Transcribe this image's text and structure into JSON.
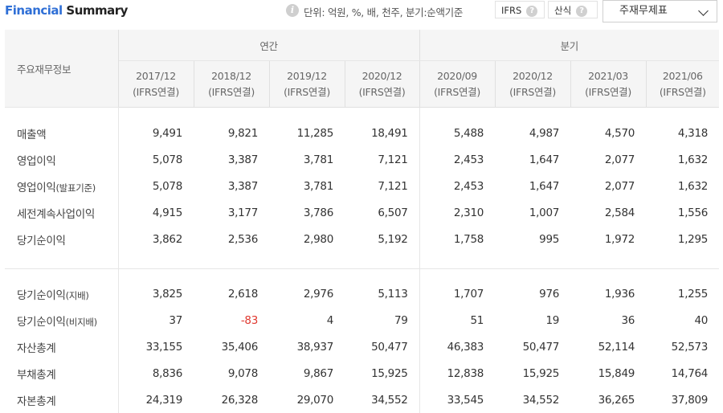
{
  "header": {
    "title_part1": "Financial",
    "title_part2": "Summary",
    "info_icon": "i",
    "unit_text": "단위: 억원, %, 배, 천주, 분기:순액기준",
    "ifrs_label": "IFRS",
    "calc_label": "산식",
    "help_icon": "?",
    "select_value": "주재무제표"
  },
  "table": {
    "label_header": "주요재무정보",
    "annual_header": "연간",
    "quarter_header": "분기",
    "periods": [
      {
        "date": "2017/12",
        "basis": "(IFRS연결)"
      },
      {
        "date": "2018/12",
        "basis": "(IFRS연결)"
      },
      {
        "date": "2019/12",
        "basis": "(IFRS연결)"
      },
      {
        "date": "2020/12",
        "basis": "(IFRS연결)"
      },
      {
        "date": "2020/09",
        "basis": "(IFRS연결)"
      },
      {
        "date": "2020/12",
        "basis": "(IFRS연결)"
      },
      {
        "date": "2021/03",
        "basis": "(IFRS연결)"
      },
      {
        "date": "2021/06",
        "basis": "(IFRS연결)"
      }
    ],
    "rows": [
      {
        "label": "매출액",
        "suffix": "",
        "values": [
          "9,491",
          "9,821",
          "11,285",
          "18,491",
          "5,488",
          "4,987",
          "4,570",
          "4,318"
        ]
      },
      {
        "label": "영업이익",
        "suffix": "",
        "values": [
          "5,078",
          "3,387",
          "3,781",
          "7,121",
          "2,453",
          "1,647",
          "2,077",
          "1,632"
        ]
      },
      {
        "label": "영업이익",
        "suffix": "(발표기준)",
        "values": [
          "5,078",
          "3,387",
          "3,781",
          "7,121",
          "2,453",
          "1,647",
          "2,077",
          "1,632"
        ]
      },
      {
        "label": "세전계속사업이익",
        "suffix": "",
        "values": [
          "4,915",
          "3,177",
          "3,786",
          "6,507",
          "2,310",
          "1,007",
          "2,584",
          "1,556"
        ]
      },
      {
        "label": "당기순이익",
        "suffix": "",
        "values": [
          "3,862",
          "2,536",
          "2,980",
          "5,192",
          "1,758",
          "995",
          "1,972",
          "1,295"
        ]
      },
      {
        "label": "당기순이익",
        "suffix": "(지배)",
        "values": [
          "3,825",
          "2,618",
          "2,976",
          "5,113",
          "1,707",
          "976",
          "1,936",
          "1,255"
        ]
      },
      {
        "label": "당기순이익",
        "suffix": "(비지배)",
        "values": [
          "37",
          "-83",
          "4",
          "79",
          "51",
          "19",
          "36",
          "40"
        ]
      },
      {
        "label": "자산총계",
        "suffix": "",
        "values": [
          "33,155",
          "35,406",
          "38,937",
          "50,477",
          "46,383",
          "50,477",
          "52,114",
          "52,573"
        ]
      },
      {
        "label": "부채총계",
        "suffix": "",
        "values": [
          "8,836",
          "9,078",
          "9,867",
          "15,925",
          "12,838",
          "15,925",
          "15,849",
          "14,764"
        ]
      },
      {
        "label": "자본총계",
        "suffix": "",
        "values": [
          "24,319",
          "26,328",
          "29,070",
          "34,552",
          "33,545",
          "34,552",
          "36,265",
          "37,809"
        ]
      }
    ],
    "negative_color": "#e0382f"
  }
}
